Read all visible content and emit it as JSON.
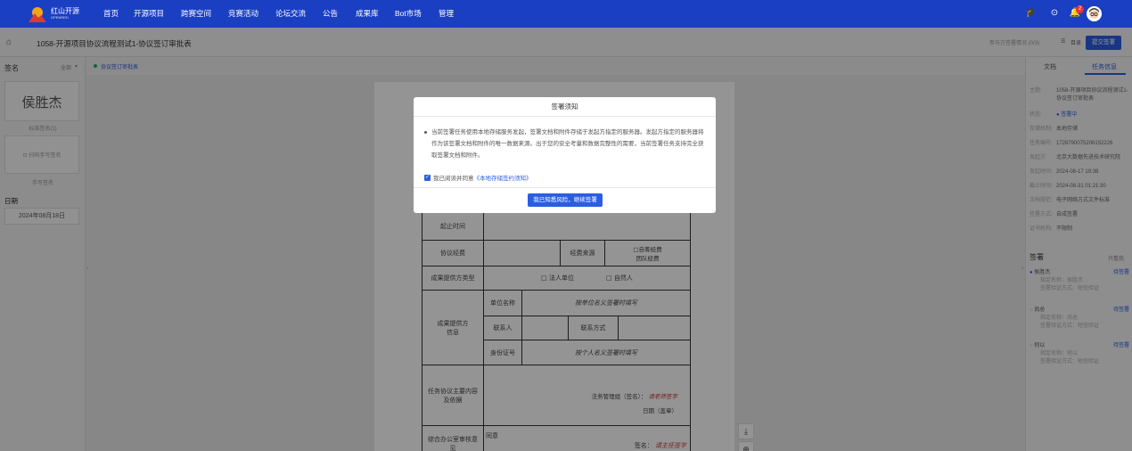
{
  "nav": {
    "logo_line1": "红山开源",
    "logo_line2": "OPENRED",
    "items": [
      "首页",
      "开源项目",
      "跨赛空间",
      "竞赛活动",
      "论坛交流",
      "公告",
      "成果库",
      "Bot市场",
      "管理"
    ],
    "badge_count": "2"
  },
  "header": {
    "title": "1058-开源项目协议流程测试1-协议签订审批表",
    "progress_text": "参与方签署情况 (0/3)",
    "menu_label": "目录",
    "submit_label": "提交签署"
  },
  "left": {
    "title": "签名",
    "all_label": "全部",
    "signature_name": "侯胜杰",
    "signature_caption": "标准签名(1)",
    "handwrite_label": "扫码手写签名",
    "handwrite_caption": "手写签名",
    "date_label": "日期",
    "date_value": "2024年08月18日"
  },
  "strip": {
    "text": "协议签订审批表"
  },
  "form": {
    "start_time": "起止时间",
    "funding": "协议经费",
    "funding_source": "经费来源",
    "opt1": "□自筹经费",
    "opt2": "团队经费",
    "provider_type": "成果提供方类型",
    "legal": "□ 法人单位",
    "natural": "□ 自然人",
    "provider_info": "成果提供方信息",
    "unit_name": "单位名称",
    "unit_name_hint": "按单位名义签署时填写",
    "contact": "联系人",
    "contact_way": "联系方式",
    "id_number": "身份证号",
    "id_hint": "按个人名义签署时填写",
    "task_content": "任务协议主要内容及依据",
    "manager_sign": "法务管理组（签名）：",
    "sign_here": "请老师签字",
    "date_seal": "日期（盖章）",
    "office_opinion": "综合办公室审核意见",
    "agree_text": "同意",
    "signature": "签名：",
    "sign_here2": "请主任签字"
  },
  "right": {
    "tabs": [
      "文档",
      "任务信息"
    ],
    "info": [
      {
        "k": "主题:",
        "v": "1058-开源项目协议流程测试1-协议签订审批表"
      },
      {
        "k": "状态:",
        "v": "● 签署中"
      },
      {
        "k": "存储机制:",
        "v": "本地存储"
      },
      {
        "k": "任务编号:",
        "v": "1728790075206152226"
      },
      {
        "k": "发起方:",
        "v": "北京大数据先进技术研究院"
      },
      {
        "k": "发起时间:",
        "v": "2024-08-17 19:38"
      },
      {
        "k": "截止时间:",
        "v": "2024-08-31 01:21:30"
      },
      {
        "k": "文档规范:",
        "v": "电子网络方式文件标准"
      },
      {
        "k": "签署方式:",
        "v": "自成签署"
      },
      {
        "k": "证书机构:",
        "v": "不限制"
      }
    ],
    "sign_title": "签署",
    "sign_toggle": "只看我",
    "signers": [
      {
        "name": "侯胜杰",
        "status": "待签署",
        "l1": "指定名称：侯胜杰",
        "l2": "签署验证方式：短信验证"
      },
      {
        "name": "尚总",
        "status": "待签署",
        "l1": "指定名称：尚总",
        "l2": "签署验证方式：短信验证"
      },
      {
        "name": "何以",
        "status": "待签署",
        "l1": "指定名称：何以",
        "l2": "签署验证方式：短信验证"
      }
    ]
  },
  "modal": {
    "title": "签署须知",
    "body": "当前签署任务使用本地存储服务发起，签署文档和附件存储于发起方指定的服务器。发起方指定的服务器将作为该签署文档和附件的唯一数据来源。出于您的安全考量和数据完整性的需要，当前签署任务支持完全获取签署文档和附件。",
    "agree_prefix": "我已阅读并同意",
    "agree_link": "《本地存储签约须知》",
    "confirm": "我已知悉风险，继续签署"
  }
}
